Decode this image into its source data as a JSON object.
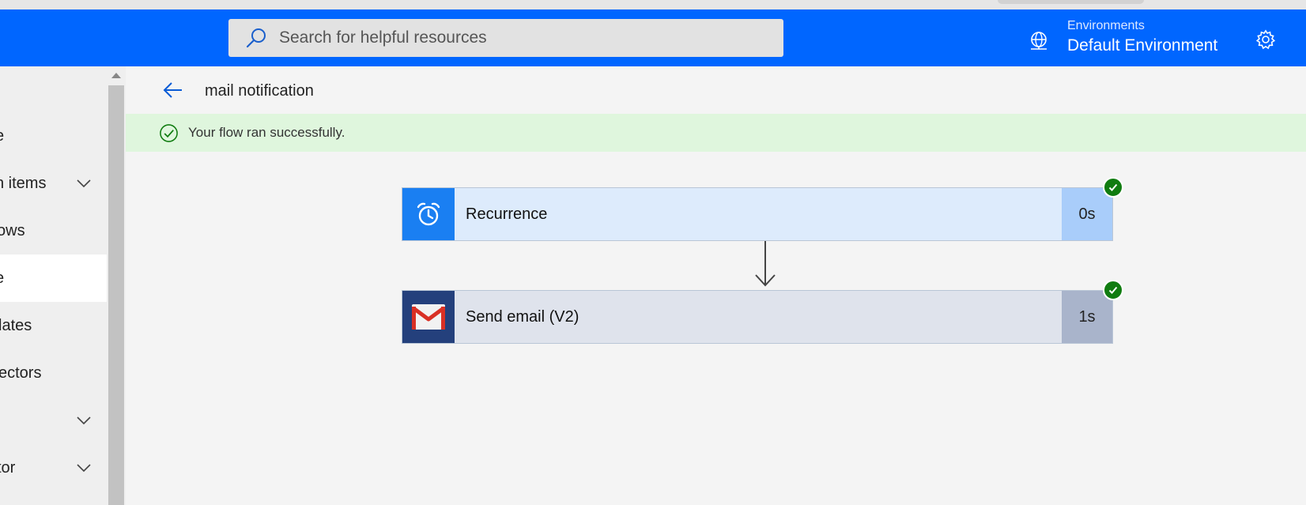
{
  "header": {
    "search": {
      "placeholder": "Search for helpful resources"
    },
    "environment": {
      "label": "Environments",
      "name": "Default Environment"
    },
    "colors": {
      "bar": "#0066ff"
    }
  },
  "sidebar": {
    "items": [
      {
        "label": "e",
        "expandable": false,
        "selected": false
      },
      {
        "label": "n items",
        "expandable": true,
        "selected": false
      },
      {
        "label": "ows",
        "expandable": false,
        "selected": false
      },
      {
        "label": "e",
        "expandable": false,
        "selected": true
      },
      {
        "label": "lates",
        "expandable": false,
        "selected": false
      },
      {
        "label": "ectors",
        "expandable": false,
        "selected": false
      },
      {
        "label": "",
        "expandable": true,
        "selected": false
      },
      {
        "label": "tor",
        "expandable": true,
        "selected": false
      }
    ]
  },
  "flow": {
    "title": "mail notification",
    "status_message": "Your flow ran successfully.",
    "steps": [
      {
        "name": "Recurrence",
        "duration": "0s",
        "icon": "alarm-clock-icon",
        "status": "succeeded"
      },
      {
        "name": "Send email (V2)",
        "duration": "1s",
        "icon": "gmail-icon",
        "status": "succeeded"
      }
    ]
  }
}
